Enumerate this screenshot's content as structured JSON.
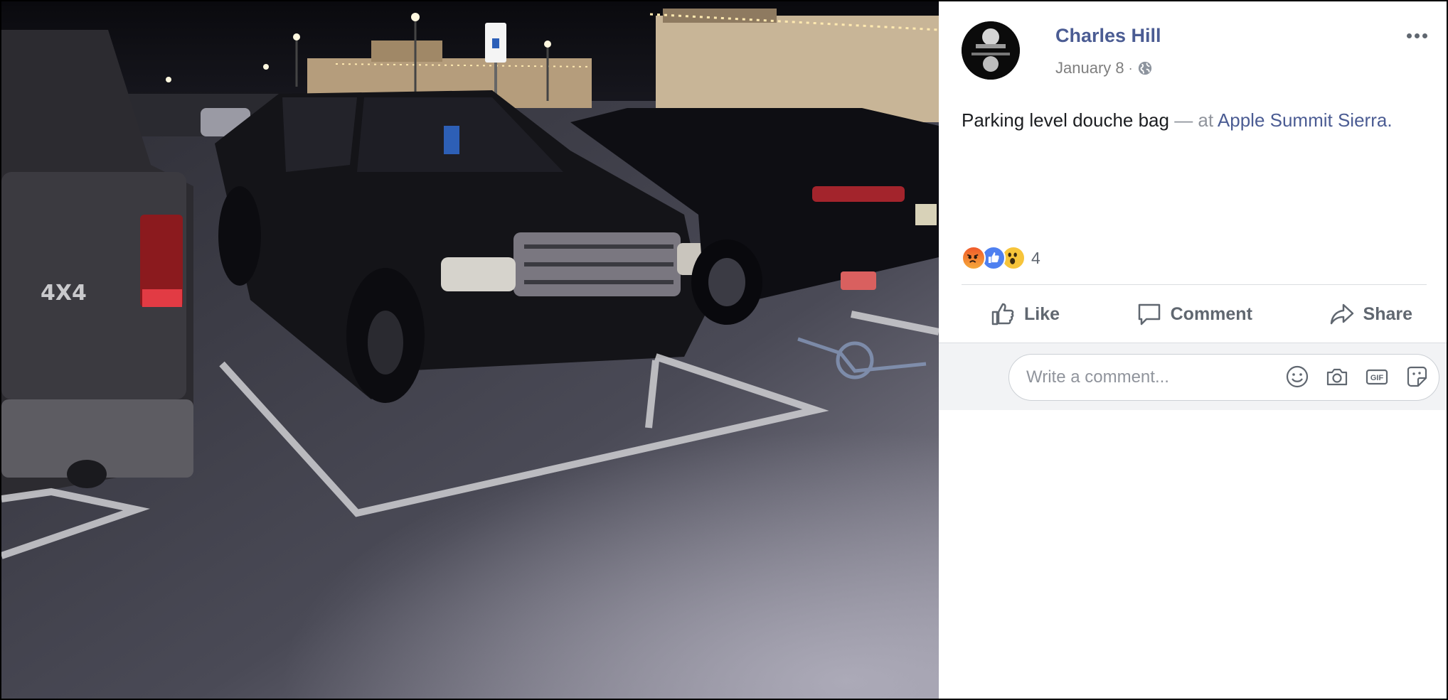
{
  "post": {
    "author": "Charles Hill",
    "date": "January 8",
    "date_separator": "·",
    "privacy_icon": "globe-icon",
    "text": "Parking level douche bag",
    "at_text": " — at ",
    "place": "Apple Summit Sierra",
    "place_suffix": ".",
    "more_icon": "more-options-icon"
  },
  "reactions": {
    "types": [
      "angry",
      "like",
      "wow"
    ],
    "count": "4"
  },
  "actions": {
    "like": "Like",
    "comment": "Comment",
    "share": "Share"
  },
  "comment": {
    "placeholder": "Write a comment...",
    "icons": [
      "emoji-icon",
      "camera-icon",
      "gif-icon",
      "sticker-icon"
    ],
    "gif_label": "GIF"
  },
  "colors": {
    "link": "#4b5c93",
    "muted": "#90949c",
    "action": "#606770",
    "comment_bg": "#f2f3f5"
  }
}
